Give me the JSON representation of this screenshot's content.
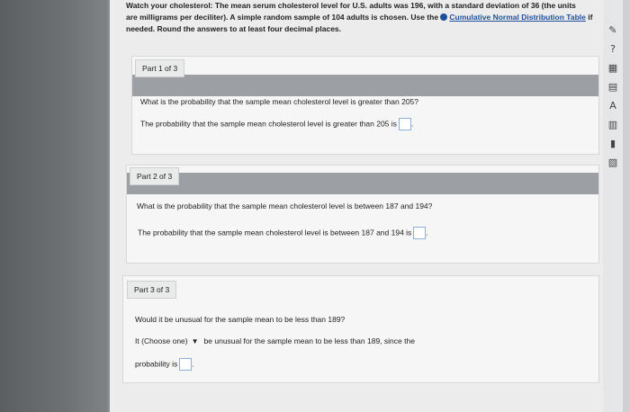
{
  "header": {
    "title_bold": "Watch your cholesterol:",
    "text_line1": " The mean serum cholesterol level for U.S. adults was 196, with a standard deviation of 36 (the units",
    "text_line2": "are milligrams per deciliter). A simple random sample of 104 adults is chosen. Use the ",
    "link_text": "Cumulative Normal Distribution Table",
    "text_line2_end": " if",
    "text_line3": "needed. Round the answers to at least four decimal places."
  },
  "part1": {
    "label": "Part 1 of 3",
    "question": "What is the probability that the sample mean cholesterol level is greater than 205?",
    "answer_prefix": "The probability that the sample mean cholesterol level is greater than 205 is"
  },
  "part2": {
    "label": "Part 2 of 3",
    "question": "What is the probability that the sample mean cholesterol level is between 187 and 194?",
    "answer_prefix": "The probability that the sample mean cholesterol level is between 187 and 194 is"
  },
  "part3": {
    "label": "Part 3 of 3",
    "question": "Would it be unusual for the sample mean to be less than 189?",
    "answer_lead": "It",
    "dropdown_value": "(Choose one)",
    "answer_mid": "be unusual for the sample mean to be less than 189, since the",
    "answer_line2": "probability is"
  },
  "icons": {
    "pencil": "✎",
    "help": "?",
    "table": "▦",
    "grid": "▤",
    "font": "A",
    "calc": "▥",
    "chart": "▮",
    "list": "▧"
  }
}
